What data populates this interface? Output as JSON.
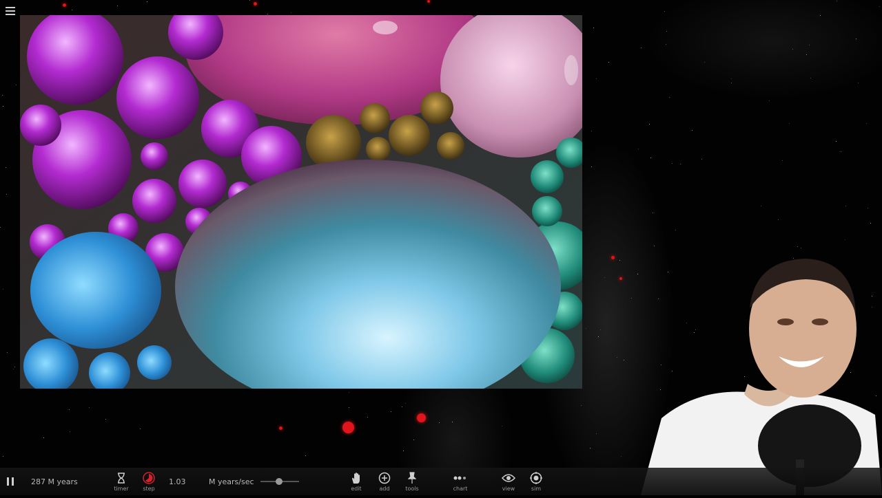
{
  "app": {
    "menu_icon": "hamburger-menu-icon"
  },
  "photo": {
    "description_icon": "oil-bubbles-photo"
  },
  "toolbar": {
    "play_state_icon": "pause-icon",
    "time_value": "287 M years",
    "timer_label": "timer",
    "step_label": "step",
    "step_value": "1.03",
    "speed_unit": "M years/sec",
    "edit_label": "edit",
    "add_label": "add",
    "tools_label": "tools",
    "chart_label": "chart",
    "view_label": "view",
    "sim_label": "sim"
  },
  "colors": {
    "background": "#000000",
    "accent_red": "#e0141a",
    "step_icon": "#d8202a",
    "toolbar_text": "#b8b8b8"
  }
}
